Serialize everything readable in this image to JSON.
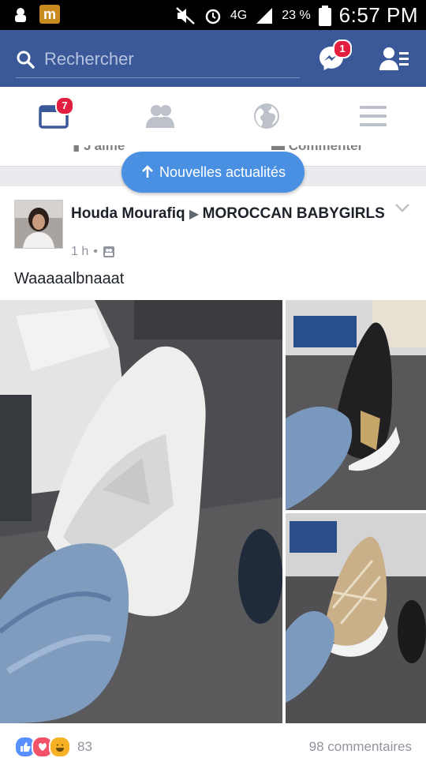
{
  "status_bar": {
    "network": "4G",
    "battery": "23 %",
    "time": "6:57 PM"
  },
  "header": {
    "search_placeholder": "Rechercher",
    "messenger_badge": "1"
  },
  "tabs": {
    "news_feed_badge": "7"
  },
  "prev_post": {
    "like_label": "J'aime",
    "comment_label": "Commenter"
  },
  "new_stories_label": "Nouvelles actualités",
  "post": {
    "author": "Houda Mourafiq",
    "group": "MOROCCAN BABYGIRLS",
    "time": "1 h",
    "text": "Waaaaalbnaaat",
    "reaction_count": "83",
    "comments": "98 commentaires"
  },
  "colors": {
    "brand": "#3b5998",
    "badge": "#e41e3f",
    "pill": "#4a90e2"
  }
}
